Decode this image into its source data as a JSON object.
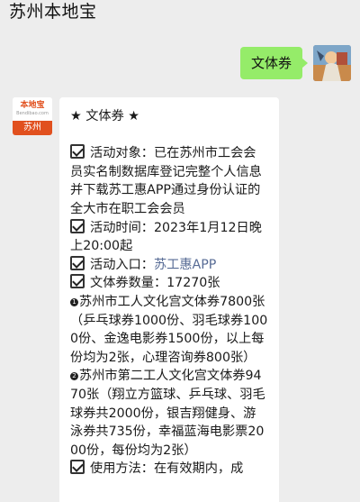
{
  "header": {
    "title": "苏州本地宝"
  },
  "outgoing": {
    "text": "文体券"
  },
  "sender_avatar": {
    "brand": "本地宝",
    "url": "Bendibao.com",
    "city": "苏州"
  },
  "message": {
    "heading": "★ 文体券 ★",
    "activity_target_label": "活动对象：",
    "activity_target": "已在苏州市工会会员实名制数据库登记完整个人信息并下载苏工惠APP通过身份认证的全大市在职工会会员",
    "activity_time_label": "活动时间：",
    "activity_time": "2023年1月12日晚上20:00起",
    "activity_entry_label": "活动入口：",
    "activity_entry": "苏工惠APP",
    "quantity_label": "文体券数量：",
    "quantity": "17270张",
    "item1_marker": "1",
    "item1": "苏州市工人文化宫文体券7800张（乒乓球券1000份、羽毛球券1000份、金逸电影券1500份，以上每份均为2张，心理咨询券800张）",
    "item2_marker": "2",
    "item2": "苏州市第二工人文化宫文体券9470张（翔立方篮球、乒乓球、羽毛球券共2000份，银吉翔健身、游泳券共735份，幸福蓝海电影票2000份，每份均为2张）",
    "usage_label": "使用方法：",
    "usage": "在有效期内，成"
  }
}
